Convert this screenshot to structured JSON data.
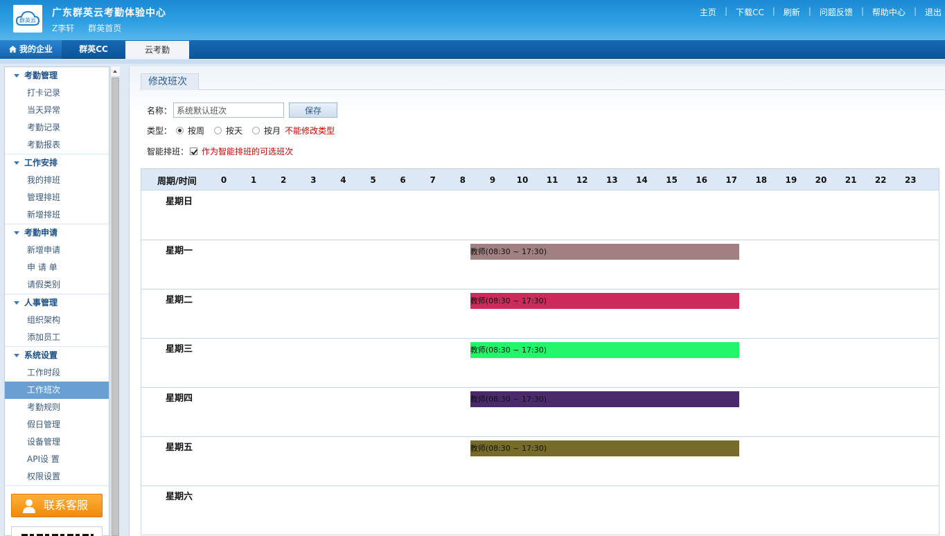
{
  "header": {
    "app_title": "广东群英云考勤体验中心",
    "user": "Z李轩",
    "home_link": "群英首页",
    "logo_text": "群英云",
    "links": [
      "主页",
      "下载CC",
      "刷新",
      "问题反馈",
      "帮助中心",
      "退出"
    ]
  },
  "nav": {
    "tabs": [
      {
        "label": "我的企业",
        "icon": "home-icon"
      },
      {
        "label": "群英CC"
      },
      {
        "label": "云考勤",
        "active": true
      }
    ]
  },
  "sidebar": {
    "groups": [
      {
        "title": "考勤管理",
        "items": [
          "打卡记录",
          "当天异常",
          "考勤记录",
          "考勤报表"
        ]
      },
      {
        "title": "工作安排",
        "items": [
          "我的排班",
          "管理排班",
          "新增排班"
        ]
      },
      {
        "title": "考勤申请",
        "items": [
          "新增申请",
          "申 请 单",
          "请假类别"
        ]
      },
      {
        "title": "人事管理",
        "items": [
          "组织架构",
          "添加员工"
        ]
      },
      {
        "title": "系统设置",
        "items": [
          "工作时段",
          "工作班次",
          "考勤规则",
          "假日管理",
          "设备管理",
          "API设 置",
          "权限设置"
        ]
      }
    ],
    "active_item": "工作班次",
    "contact_button": "联系客服"
  },
  "panel": {
    "title": "修改班次",
    "name_label": "名称：",
    "name_value": "系统默认班次",
    "save_label": "保存",
    "type_label": "类型：",
    "type_options": [
      {
        "label": "按周",
        "checked": true
      },
      {
        "label": "按天",
        "checked": false
      },
      {
        "label": "按月",
        "checked": false
      }
    ],
    "type_warning": "不能修改类型",
    "smart_label": "智能排班：",
    "smart_checked": true,
    "smart_text": "作为智能排班的可选班次"
  },
  "schedule": {
    "corner_label": "周期/时间",
    "hours": [
      "0",
      "1",
      "2",
      "3",
      "4",
      "5",
      "6",
      "7",
      "8",
      "9",
      "10",
      "11",
      "12",
      "13",
      "14",
      "15",
      "16",
      "17",
      "18",
      "19",
      "20",
      "21",
      "22",
      "23"
    ],
    "days": [
      {
        "label": "星期日",
        "shift": null
      },
      {
        "label": "星期一",
        "shift": {
          "text": "教师(08:30 ~ 17:30)",
          "start": 8.5,
          "end": 17.5,
          "color": "#a08080"
        }
      },
      {
        "label": "星期二",
        "shift": {
          "text": "教师(08:30 ~ 17:30)",
          "start": 8.5,
          "end": 17.5,
          "color": "#cc2a5b"
        }
      },
      {
        "label": "星期三",
        "shift": {
          "text": "教师(08:30 ~ 17:30)",
          "start": 8.5,
          "end": 17.5,
          "color": "#23f56a"
        }
      },
      {
        "label": "星期四",
        "shift": {
          "text": "教师(08:30 ~ 17:30)",
          "start": 8.5,
          "end": 17.5,
          "color": "#4b2a6c"
        }
      },
      {
        "label": "星期五",
        "shift": {
          "text": "教师(08:30 ~ 17:30)",
          "start": 8.5,
          "end": 17.5,
          "color": "#766b28"
        }
      },
      {
        "label": "星期六",
        "shift": null
      }
    ]
  }
}
